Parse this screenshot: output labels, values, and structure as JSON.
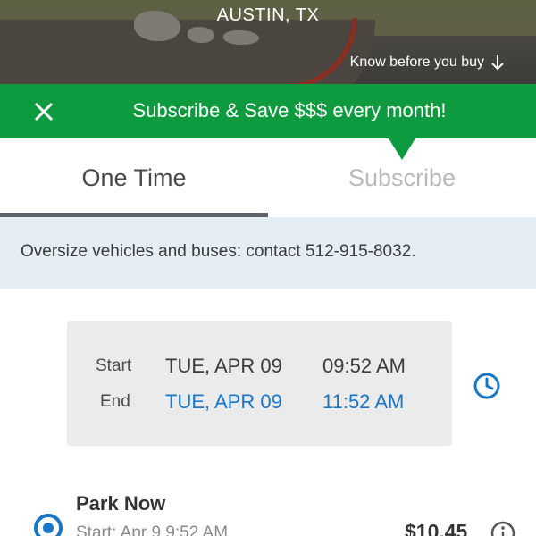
{
  "hero": {
    "city": "AUSTIN, TX",
    "know_before": "Know before you buy"
  },
  "banner": {
    "text": "Subscribe & Save $$$ every month!",
    "color": "#0e9a3f"
  },
  "tabs": [
    {
      "label": "One Time",
      "active": true
    },
    {
      "label": "Subscribe",
      "active": false
    }
  ],
  "notice": {
    "text": "Oversize vehicles and buses: contact 512-915-8032."
  },
  "time_card": {
    "start_label": "Start",
    "start_date": "TUE, APR 09",
    "start_time": "09:52 AM",
    "end_label": "End",
    "end_date": "TUE, APR 09",
    "end_time": "11:52 AM"
  },
  "park_now": {
    "title": "Park Now",
    "start": "Start: Apr 9 9:52 AM",
    "price": "$10.45"
  },
  "colors": {
    "accent_blue": "#1976c6",
    "tab_underline": "#5f6368",
    "notice_bg": "#e4eef4"
  },
  "icons": [
    "close-icon",
    "arrow-down-icon",
    "clock-icon",
    "location-pin-icon",
    "info-icon"
  ]
}
